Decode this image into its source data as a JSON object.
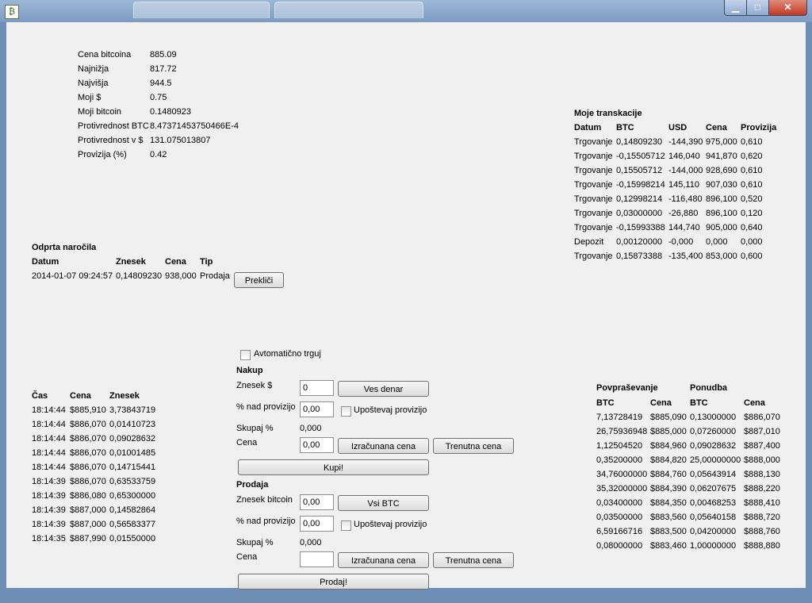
{
  "stats": [
    {
      "label": "Cena bitcoina",
      "value": "885.09"
    },
    {
      "label": "Najnižja",
      "value": "817.72"
    },
    {
      "label": "Najvišja",
      "value": "944.5"
    },
    {
      "label": "Moji $",
      "value": "0.75"
    },
    {
      "label": "Moji bitcoin",
      "value": "0.1480923"
    },
    {
      "label": "Protivrednost BTC",
      "value": "8.47371453750466E-4"
    },
    {
      "label": "Protivrednost v $",
      "value": "131.075013807"
    },
    {
      "label": "Provizija (%)",
      "value": "0.42"
    }
  ],
  "transactions": {
    "title": "Moje transkacije",
    "headers": [
      "Datum",
      "BTC",
      "USD",
      "Cena",
      "Provizija"
    ],
    "rows": [
      [
        "Trgovanje",
        "0,14809230",
        "-144,390",
        "975,000",
        "0,610"
      ],
      [
        "Trgovanje",
        "-0,15505712",
        "146,040",
        "941,870",
        "0,620"
      ],
      [
        "Trgovanje",
        "0,15505712",
        "-144,000",
        "928,690",
        "0,610"
      ],
      [
        "Trgovanje",
        "-0,15998214",
        "145,110",
        "907,030",
        "0,610"
      ],
      [
        "Trgovanje",
        "0,12998214",
        "-116,480",
        "896,100",
        "0,520"
      ],
      [
        "Trgovanje",
        "0,03000000",
        "-26,880",
        "896,100",
        "0,120"
      ],
      [
        "Trgovanje",
        "-0,15993388",
        "144,740",
        "905,000",
        "0,640"
      ],
      [
        "Depozit",
        "0,00120000",
        "-0,000",
        "0,000",
        "0,000"
      ],
      [
        "Trgovanje",
        "0,15873388",
        "-135,400",
        "853,000",
        "0,600"
      ]
    ]
  },
  "open_orders": {
    "title": "Odprta naročila",
    "headers": [
      "Datum",
      "Znesek",
      "Cena",
      "Tip"
    ],
    "rows": [
      [
        "2014-01-07 09:24:57",
        "0,14809230",
        "938,000",
        "Prodaja"
      ]
    ],
    "cancel_label": "Prekliči"
  },
  "auto_trade_label": "Avtomatično trguj",
  "buy": {
    "title": "Nakup",
    "amount_label": "Znesek $",
    "amount_value": "0",
    "all_money_label": "Ves denar",
    "above_fee_label": "% nad provizijo",
    "above_fee_value": "0,00",
    "consider_fee_label": "Upoštevaj provizijo",
    "total_label": "Skupaj %",
    "total_value": "0,000",
    "price_label": "Cena",
    "price_value": "0,00",
    "calc_price_label": "Izračunana cena",
    "current_price_label": "Trenutna cena",
    "buy_button_label": "Kupi!"
  },
  "sell": {
    "title": "Prodaja",
    "amount_label": "Znesek bitcoin",
    "amount_value": "0,00",
    "all_btc_label": "Vsi BTC",
    "above_fee_label": "% nad provizijo",
    "above_fee_value": "0,00",
    "consider_fee_label": "Upoštevaj provizijo",
    "total_label": "Skupaj %",
    "total_value": "0,000",
    "price_label": "Cena",
    "price_value": "",
    "calc_price_label": "Izračunana cena",
    "current_price_label": "Trenutna cena",
    "sell_button_label": "Prodaj!"
  },
  "trades": {
    "headers": [
      "Čas",
      "Cena",
      "Znesek"
    ],
    "rows": [
      [
        "18:14:44",
        "$885,910",
        "3,73843719"
      ],
      [
        "18:14:44",
        "$886,070",
        "0,01410723"
      ],
      [
        "18:14:44",
        "$886,070",
        "0,09028632"
      ],
      [
        "18:14:44",
        "$886,070",
        "0,01001485"
      ],
      [
        "18:14:44",
        "$886,070",
        "0,14715441"
      ],
      [
        "18:14:39",
        "$886,070",
        "0,63533759"
      ],
      [
        "18:14:39",
        "$886,080",
        "0,65300000"
      ],
      [
        "18:14:39",
        "$887,000",
        "0,14582864"
      ],
      [
        "18:14:39",
        "$887,000",
        "0,56583377"
      ],
      [
        "18:14:35",
        "$887,990",
        "0,01550000"
      ]
    ]
  },
  "order_book": {
    "bids_title": "Povpraševanje",
    "asks_title": "Ponudba",
    "headers": [
      "BTC",
      "Cena",
      "BTC",
      "Cena"
    ],
    "rows": [
      [
        "7,13728419",
        "$885,090",
        "0,13000000",
        "$886,070"
      ],
      [
        "26,75936948",
        "$885,000",
        "0,07260000",
        "$887,010"
      ],
      [
        "1,12504520",
        "$884,960",
        "0,09028632",
        "$887,400"
      ],
      [
        "0,35200000",
        "$884,820",
        "25,00000000",
        "$888,000"
      ],
      [
        "34,76000000",
        "$884,760",
        "0,05643914",
        "$888,130"
      ],
      [
        "35,32000000",
        "$884,390",
        "0,06207675",
        "$888,220"
      ],
      [
        "0,03400000",
        "$884,350",
        "0,00468253",
        "$888,410"
      ],
      [
        "0,03500000",
        "$883,560",
        "0,05640158",
        "$888,720"
      ],
      [
        "6,59166716",
        "$883,500",
        "0,04200000",
        "$888,760"
      ],
      [
        "0,08000000",
        "$883,460",
        "1,00000000",
        "$888,880"
      ]
    ]
  }
}
